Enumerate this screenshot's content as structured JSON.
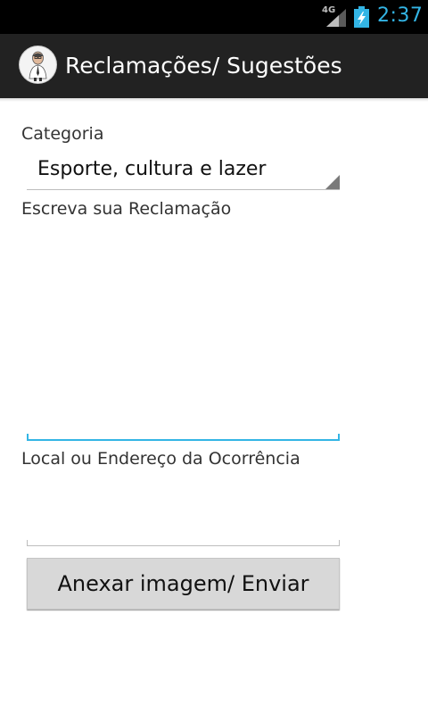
{
  "status_bar": {
    "network_type": "4G",
    "time": "2:37",
    "icons": [
      "signal-icon",
      "battery-charging-icon"
    ]
  },
  "action_bar": {
    "title": "Reclamações/ Sugestões",
    "app_icon": "app-avatar-icon"
  },
  "form": {
    "category_label": "Categoria",
    "category_value": "Esporte, cultura e lazer",
    "complaint_label": "Escreva sua Reclamação",
    "complaint_value": "",
    "location_label": "Local ou Endereço da Ocorrência",
    "location_value": "",
    "submit_label": "Anexar imagem/ Enviar"
  },
  "colors": {
    "accent": "#33b5e5",
    "action_bar": "#222222",
    "status_bar": "#000000",
    "button": "#d8d8d8"
  }
}
